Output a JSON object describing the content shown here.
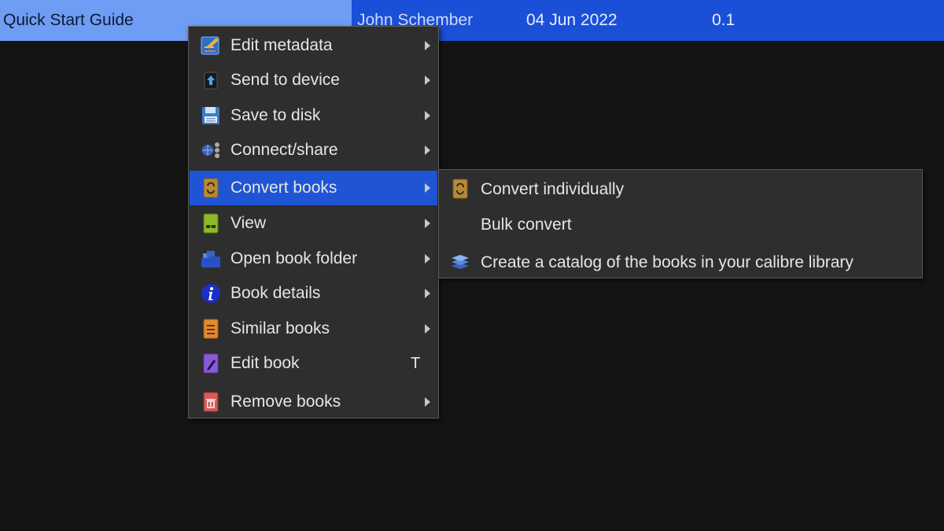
{
  "book_row": {
    "title": "Quick Start Guide",
    "author": "John Schember",
    "date": "04 Jun 2022",
    "size": "0.1"
  },
  "context_menu": {
    "items": [
      {
        "label": "Edit metadata",
        "icon": "edit-metadata-icon",
        "submenu": true
      },
      {
        "label": "Send to device",
        "icon": "send-to-device-icon",
        "submenu": true
      },
      {
        "label": "Save to disk",
        "icon": "save-disk-icon",
        "submenu": true
      },
      {
        "label": "Connect/share",
        "icon": "connect-share-icon",
        "submenu": true
      },
      {
        "label": "Convert books",
        "icon": "convert-books-icon",
        "submenu": true,
        "active": true
      },
      {
        "label": "View",
        "icon": "view-icon",
        "submenu": true
      },
      {
        "label": "Open book folder",
        "icon": "folder-icon",
        "submenu": true
      },
      {
        "label": "Book details",
        "icon": "info-icon",
        "submenu": true
      },
      {
        "label": "Similar books",
        "icon": "similar-books-icon",
        "submenu": true
      },
      {
        "label": "Edit book",
        "icon": "edit-book-icon",
        "shortcut": "T"
      },
      {
        "label": "Remove books",
        "icon": "remove-books-icon",
        "submenu": true
      }
    ]
  },
  "convert_submenu": {
    "items": [
      {
        "label": "Convert individually",
        "icon": "convert-individually-icon"
      },
      {
        "label": "Bulk convert",
        "icon": ""
      },
      {
        "label": "Create a catalog of the books in your calibre library",
        "icon": "catalog-icon"
      }
    ]
  },
  "colors": {
    "selection": "#1f55d4",
    "row_highlight": "#1a4fd8",
    "title_cell": "#6f9df4",
    "menu_bg": "#2e2e2e",
    "background": "#141414"
  }
}
